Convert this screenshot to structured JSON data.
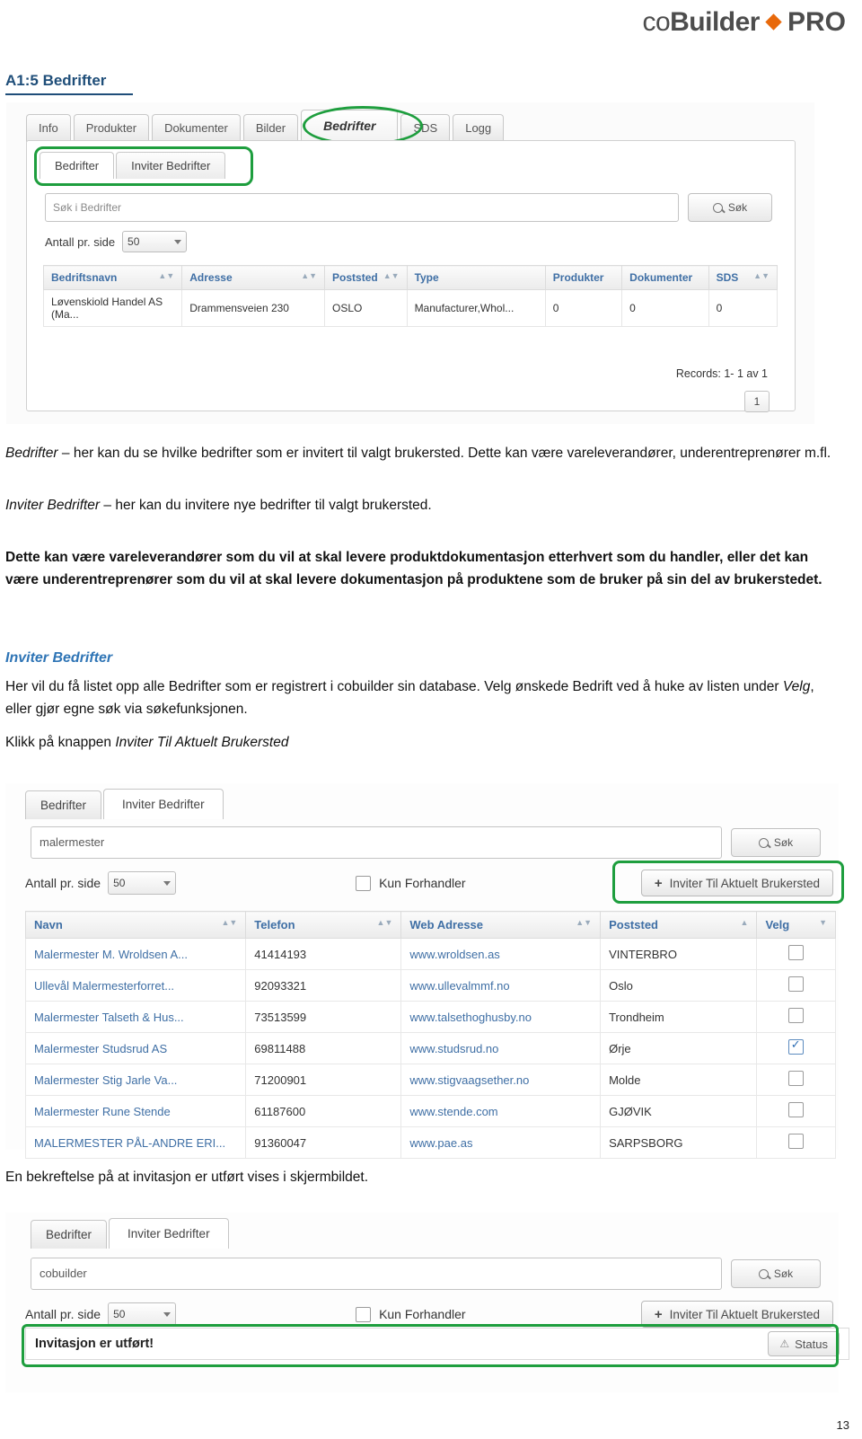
{
  "brand": {
    "co": "co",
    "builder": "Builder",
    "pro": "PRO"
  },
  "section": {
    "title": "A1:5 Bedrifter"
  },
  "screenshot1": {
    "tabs": [
      "Info",
      "Produkter",
      "Dokumenter",
      "Bilder",
      "Bedrifter",
      "SDS",
      "Logg"
    ],
    "active_tab": "Bedrifter",
    "subtabs": [
      "Bedrifter",
      "Inviter Bedrifter"
    ],
    "search_placeholder": "Søk i Bedrifter",
    "search_button": "Søk",
    "per_page_label": "Antall pr. side",
    "per_page_value": "50",
    "columns": [
      "Bedriftsnavn",
      "Adresse",
      "Poststed",
      "Type",
      "Produkter",
      "Dokumenter",
      "SDS"
    ],
    "rows": [
      {
        "navn": "Løvenskiold Handel AS (Ma...",
        "adresse": "Drammensveien 230",
        "poststed": "OSLO",
        "type": "Manufacturer,Whol...",
        "produkter": "0",
        "dokumenter": "0",
        "sds": "0"
      }
    ],
    "records": "Records: 1- 1 av 1",
    "page_number": "1"
  },
  "body": {
    "p1_italic": "Bedrifter",
    "p1_rest": " – her kan du se hvilke bedrifter som er invitert til valgt brukersted. Dette kan være vareleverandører, underentreprenører m.fl.",
    "p2_italic": "Inviter Bedrifter",
    "p2_rest": " – her kan du invitere nye bedrifter til valgt brukersted.",
    "p3": "Dette kan være vareleverandører som du vil at skal levere produktdokumentasjon etterhvert som du handler, eller det kan være underentreprenører som du vil at skal levere dokumentasjon på produktene som de bruker på sin del av brukerstedet.",
    "heading2": "Inviter Bedrifter",
    "p4_a": "Her vil du få listet opp alle Bedrifter som er registrert i cobuilder sin database. Velg ønskede Bedrift ved å huke av listen under ",
    "p4_italic": "Velg",
    "p4_b": ", eller gjør egne søk via søkefunksjonen.",
    "p5_a": "Klikk på knappen ",
    "p5_italic": "Inviter Til Aktuelt Brukersted",
    "caption1": "En bekreftelse på at invitasjon er utført vises i skjermbildet."
  },
  "screenshot2": {
    "subtabs": [
      "Bedrifter",
      "Inviter Bedrifter"
    ],
    "search_value": "malermester",
    "search_button": "Søk",
    "per_page_label": "Antall pr. side",
    "per_page_value": "50",
    "kun_forhandler_label": "Kun Forhandler",
    "invite_button": "Inviter Til Aktuelt Brukersted",
    "columns": [
      "Navn",
      "Telefon",
      "Web Adresse",
      "Poststed",
      "Velg"
    ],
    "rows": [
      {
        "navn": "Malermester M. Wroldsen A...",
        "telefon": "41414193",
        "web": "www.wroldsen.as",
        "poststed": "VINTERBRO",
        "checked": false
      },
      {
        "navn": "Ullevål Malermesterforret...",
        "telefon": "92093321",
        "web": "www.ullevalmmf.no",
        "poststed": "Oslo",
        "checked": false
      },
      {
        "navn": "Malermester Talseth & Hus...",
        "telefon": "73513599",
        "web": "www.talsethoghusby.no",
        "poststed": "Trondheim",
        "checked": false
      },
      {
        "navn": "Malermester Studsrud AS",
        "telefon": "69811488",
        "web": "www.studsrud.no",
        "poststed": "Ørje",
        "checked": true
      },
      {
        "navn": "Malermester Stig Jarle Va...",
        "telefon": "71200901",
        "web": "www.stigvaagsether.no",
        "poststed": "Molde",
        "checked": false
      },
      {
        "navn": "Malermester Rune Stende",
        "telefon": "61187600",
        "web": "www.stende.com",
        "poststed": "GJØVIK",
        "checked": false
      },
      {
        "navn": "MALERMESTER PÅL-ANDRE ERI...",
        "telefon": "91360047",
        "web": "www.pae.as",
        "poststed": "SARPSBORG",
        "checked": false
      }
    ]
  },
  "screenshot3": {
    "subtabs": [
      "Bedrifter",
      "Inviter Bedrifter"
    ],
    "search_value": "cobuilder",
    "search_button": "Søk",
    "per_page_label": "Antall pr. side",
    "per_page_value": "50",
    "kun_forhandler_label": "Kun Forhandler",
    "invite_button": "Inviter Til Aktuelt Brukersted",
    "confirm_text": "Invitasjon er utført!",
    "status_button": "Status"
  },
  "footer": {
    "page": "13"
  },
  "colors": {
    "accent_orange": "#e8690b",
    "heading_blue": "#1f4e79",
    "link_blue": "#3f6fa5",
    "highlight_green": "#1e9e3e"
  }
}
